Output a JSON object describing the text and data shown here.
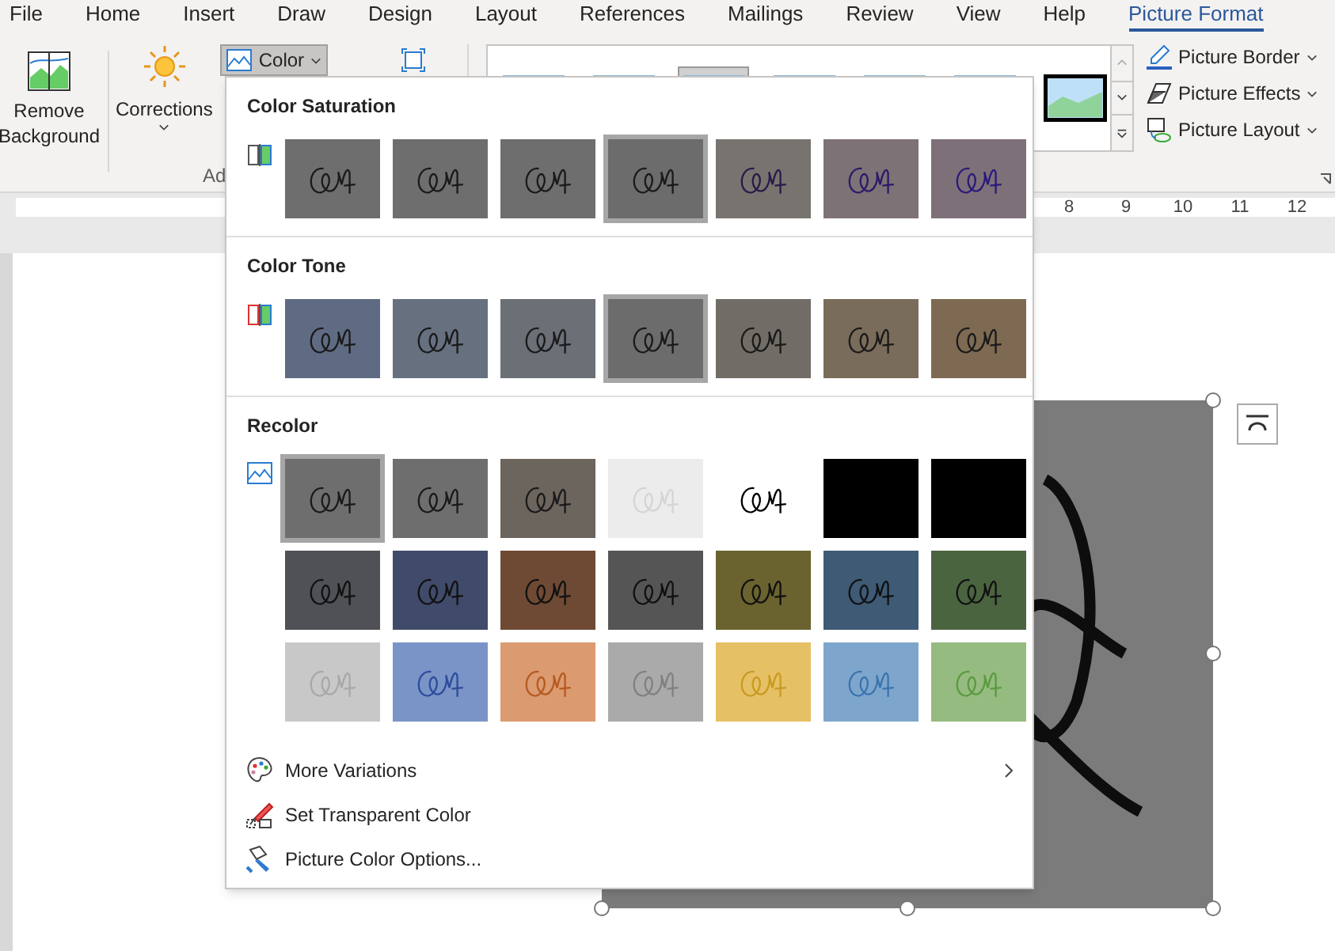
{
  "tabs": [
    {
      "label": "File",
      "selected": false
    },
    {
      "label": "Home",
      "selected": false
    },
    {
      "label": "Insert",
      "selected": false
    },
    {
      "label": "Draw",
      "selected": false
    },
    {
      "label": "Design",
      "selected": false
    },
    {
      "label": "Layout",
      "selected": false
    },
    {
      "label": "References",
      "selected": false
    },
    {
      "label": "Mailings",
      "selected": false
    },
    {
      "label": "Review",
      "selected": false
    },
    {
      "label": "View",
      "selected": false
    },
    {
      "label": "Help",
      "selected": false
    },
    {
      "label": "Picture Format",
      "selected": true
    }
  ],
  "ribbon": {
    "remove_background": "Remove Background",
    "corrections": "Corrections",
    "color": {
      "label": "Color",
      "pressed": true
    },
    "group_label": "Ad",
    "styles": [
      {
        "selected": false
      },
      {
        "selected": false
      },
      {
        "selected": true
      },
      {
        "selected": false
      },
      {
        "selected": false
      },
      {
        "selected": false
      },
      {
        "selected": false
      }
    ],
    "picture_commands": [
      "Picture Border",
      "Picture Effects",
      "Picture Layout"
    ]
  },
  "ruler": [
    "8",
    "9",
    "10",
    "11",
    "12"
  ],
  "color_menu": {
    "sections": [
      {
        "kind": "saturation",
        "title": "Color Saturation",
        "rows": [
          [
            {
              "color": "#6e6e6e",
              "ink": {
                "color": "#1a1a1a"
              },
              "selected": false
            },
            {
              "color": "#6e6e6e",
              "ink": {
                "color": "#1a1a1a"
              },
              "selected": false
            },
            {
              "color": "#6e6e6e",
              "ink": {
                "color": "#1a1a1a"
              },
              "selected": false
            },
            {
              "color": "#6c6c6c",
              "ink": {
                "color": "#1a1a1a"
              },
              "selected": true
            },
            {
              "color": "#77746f",
              "ink": {
                "color": "#2a1a4a"
              },
              "selected": false
            },
            {
              "color": "#7d7275",
              "ink": {
                "color": "#2a1a6a"
              },
              "selected": false
            },
            {
              "color": "#7e7079",
              "ink": {
                "color": "#2a1a7a"
              },
              "selected": false
            }
          ]
        ]
      },
      {
        "kind": "tone",
        "title": "Color Tone",
        "rows": [
          [
            {
              "color": "#5f6b82",
              "ink": {
                "color": "#1a1a1a"
              },
              "selected": false
            },
            {
              "color": "#66707f",
              "ink": {
                "color": "#1a1a1a"
              },
              "selected": false
            },
            {
              "color": "#6b6f76",
              "ink": {
                "color": "#1a1a1a"
              },
              "selected": false
            },
            {
              "color": "#6c6c6c",
              "ink": {
                "color": "#1a1a1a"
              },
              "selected": true
            },
            {
              "color": "#716d66",
              "ink": {
                "color": "#1a1a1a"
              },
              "selected": false
            },
            {
              "color": "#7a6c5a",
              "ink": {
                "color": "#1a1a1a"
              },
              "selected": false
            },
            {
              "color": "#7e6a52",
              "ink": {
                "color": "#1a1a1a"
              },
              "selected": false
            }
          ]
        ]
      },
      {
        "kind": "recolor",
        "title": "Recolor",
        "rows": [
          [
            {
              "color": "#6e6e6e",
              "ink": {
                "color": "#1a1a1a"
              },
              "selected": true
            },
            {
              "color": "#6e6e6e",
              "ink": {
                "color": "#1a1a1a"
              },
              "selected": false
            },
            {
              "color": "#6c655e",
              "ink": {
                "color": "#1a1a1a"
              },
              "selected": false
            },
            {
              "color": "#ececec",
              "ink": {
                "color": "#d4d4d4"
              },
              "selected": false
            },
            {
              "color": "#ffffff",
              "ink": {
                "color": "#000000"
              },
              "selected": false
            },
            {
              "color": "#000000",
              "selected": false
            },
            {
              "color": "#000000",
              "selected": false
            }
          ],
          [
            {
              "color": "#4f5157",
              "ink": {
                "color": "#111111"
              },
              "selected": false
            },
            {
              "color": "#404b6b",
              "ink": {
                "color": "#111111"
              },
              "selected": false
            },
            {
              "color": "#6e4a34",
              "ink": {
                "color": "#111111"
              },
              "selected": false
            },
            {
              "color": "#555555",
              "ink": {
                "color": "#111111"
              },
              "selected": false
            },
            {
              "color": "#6a6330",
              "ink": {
                "color": "#111111"
              },
              "selected": false
            },
            {
              "color": "#3e5a75",
              "ink": {
                "color": "#111111"
              },
              "selected": false
            },
            {
              "color": "#4b6440",
              "ink": {
                "color": "#111111"
              },
              "selected": false
            }
          ],
          [
            {
              "color": "#c8c8c8",
              "ink": {
                "color": "#a8a8a8"
              },
              "selected": false
            },
            {
              "color": "#7a94c8",
              "ink": {
                "color": "#2d4c9a"
              },
              "selected": false
            },
            {
              "color": "#dc9a70",
              "ink": {
                "color": "#b55a20"
              },
              "selected": false
            },
            {
              "color": "#aaaaaa",
              "ink": {
                "color": "#808080"
              },
              "selected": false
            },
            {
              "color": "#e6c065",
              "ink": {
                "color": "#c89a20"
              },
              "selected": false
            },
            {
              "color": "#7ea6cc",
              "ink": {
                "color": "#3a74b0"
              },
              "selected": false
            },
            {
              "color": "#96bb80",
              "ink": {
                "color": "#5a9a40"
              },
              "selected": false
            }
          ]
        ]
      }
    ],
    "commands": [
      {
        "label": "More Variations",
        "submenu": true
      },
      {
        "label": "Set Transparent Color",
        "submenu": false
      },
      {
        "label": "Picture Color Options...",
        "submenu": false
      }
    ]
  }
}
